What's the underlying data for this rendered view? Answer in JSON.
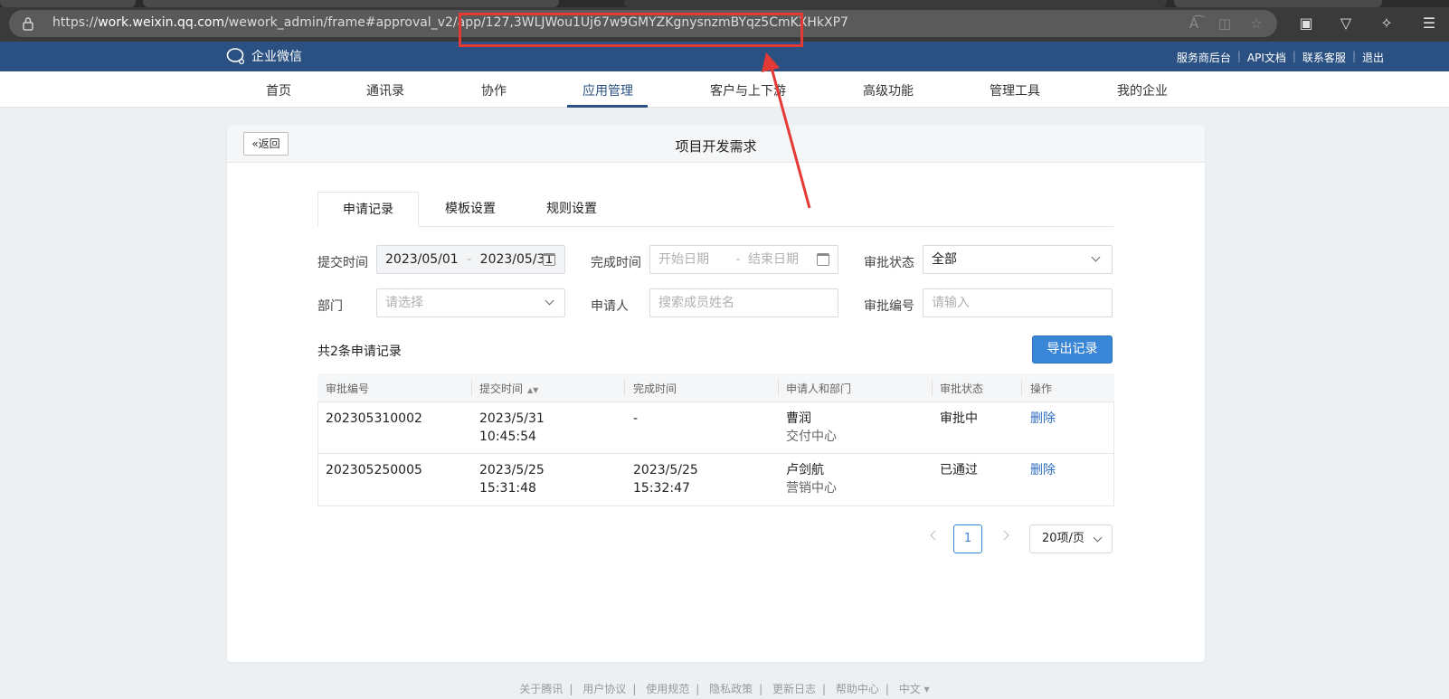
{
  "browser": {
    "url_prefix": "https://",
    "url_domain": "work.weixin.qq.com",
    "url_path": "/wework_admin/frame#approval_v2/app/127,3WLJWou1Uj67w9GMYZKgnysnzmBYqz5CmKXHkXP7",
    "icons": [
      "lock-icon",
      "read-aloud-icon",
      "split-screen-icon",
      "favorite-icon",
      "extension-face-icon",
      "vivaldi-icon",
      "puzzle-icon",
      "collections-icon"
    ]
  },
  "header": {
    "logo_text": "企业微信",
    "links": [
      "服务商后台",
      "API文档",
      "联系客服",
      "退出"
    ]
  },
  "nav": {
    "items": [
      "首页",
      "通讯录",
      "协作",
      "应用管理",
      "客户与上下游",
      "高级功能",
      "管理工具",
      "我的企业"
    ]
  },
  "page": {
    "back_label": "返回",
    "title": "项目开发需求",
    "tabs": [
      "申请记录",
      "模板设置",
      "规则设置"
    ]
  },
  "filters": {
    "submit_time_label": "提交时间",
    "submit_start": "2023/05/01",
    "submit_end": "2023/05/31",
    "range_sep": "-",
    "complete_time_label": "完成时间",
    "complete_start_ph": "开始日期",
    "complete_end_ph": "结束日期",
    "status_label": "审批状态",
    "status_value": "全部",
    "dept_label": "部门",
    "dept_ph": "请选择",
    "applicant_label": "申请人",
    "applicant_ph": "搜索成员姓名",
    "number_label": "审批编号",
    "number_ph": "请输入"
  },
  "records": {
    "count_text": "共2条申请记录",
    "export_label": "导出记录"
  },
  "table": {
    "headers": [
      "审批编号",
      "提交时间",
      "完成时间",
      "申请人和部门",
      "审批状态",
      "操作"
    ],
    "rows": [
      {
        "id": "202305310002",
        "submit_date": "2023/5/31",
        "submit_time": "10:45:54",
        "complete_date": "-",
        "complete_time": "",
        "name": "曹润",
        "dept": "交付中心",
        "status": "审批中",
        "action": "删除"
      },
      {
        "id": "202305250005",
        "submit_date": "2023/5/25",
        "submit_time": "15:31:48",
        "complete_date": "2023/5/25",
        "complete_time": "15:32:47",
        "name": "卢剑航",
        "dept": "营销中心",
        "status": "已通过",
        "action": "删除"
      }
    ]
  },
  "pagination": {
    "page": "1",
    "page_size": "20项/页"
  },
  "footer": {
    "links": [
      "关于腾讯",
      "用户协议",
      "使用规范",
      "隐私政策",
      "更新日志",
      "帮助中心",
      "中文 ▾"
    ]
  },
  "colors": {
    "header_bg": "#2b5182",
    "primary": "#3a86d6",
    "annotation": "#e53935"
  }
}
